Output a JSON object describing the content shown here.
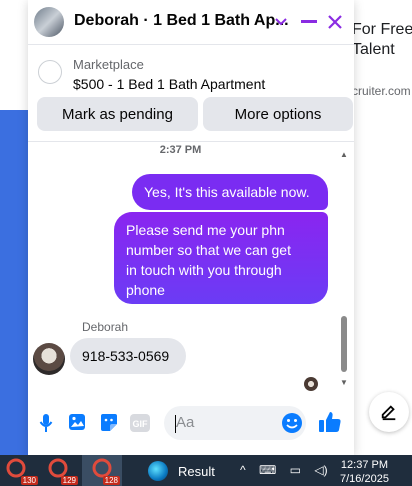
{
  "background": {
    "headline": "For Free\nTalent",
    "link_text": "cruiter.com"
  },
  "chat": {
    "title": "Deborah · 1 Bed 1 Bath Ap...",
    "listing": {
      "source": "Marketplace",
      "title": "$500 - 1 Bed 1 Bath Apartment",
      "mark_pending_label": "Mark as pending",
      "more_options_label": "More options"
    },
    "timestamp": "2:37 PM",
    "messages": [
      {
        "from": "me",
        "text": "Yes, It's this available now."
      },
      {
        "from": "me",
        "text": "Please send me your phn\nnumber so that we can get\nin touch with you through\nphone"
      },
      {
        "from": "Deborah",
        "text": "918-533-0569"
      }
    ],
    "sender_name": "Deborah",
    "composer": {
      "placeholder": "Aa",
      "value": ""
    },
    "colors": {
      "accent": "#8a2be2",
      "bubble_out": "#7a2cf2",
      "bubble_in": "#e4e6eb",
      "icon_blue": "#0a7cff"
    },
    "icons": [
      "chevron-down-icon",
      "minimize-icon",
      "close-icon",
      "microphone-icon",
      "photo-icon",
      "sticker-icon",
      "gif-icon",
      "emoji-icon",
      "thumbs-up-icon"
    ]
  },
  "taskbar": {
    "apps": [
      {
        "badge": "130"
      },
      {
        "badge": "129"
      },
      {
        "badge": "128"
      }
    ],
    "active_label": "Result",
    "time": "12:37 PM",
    "date": "7/16/2025"
  }
}
